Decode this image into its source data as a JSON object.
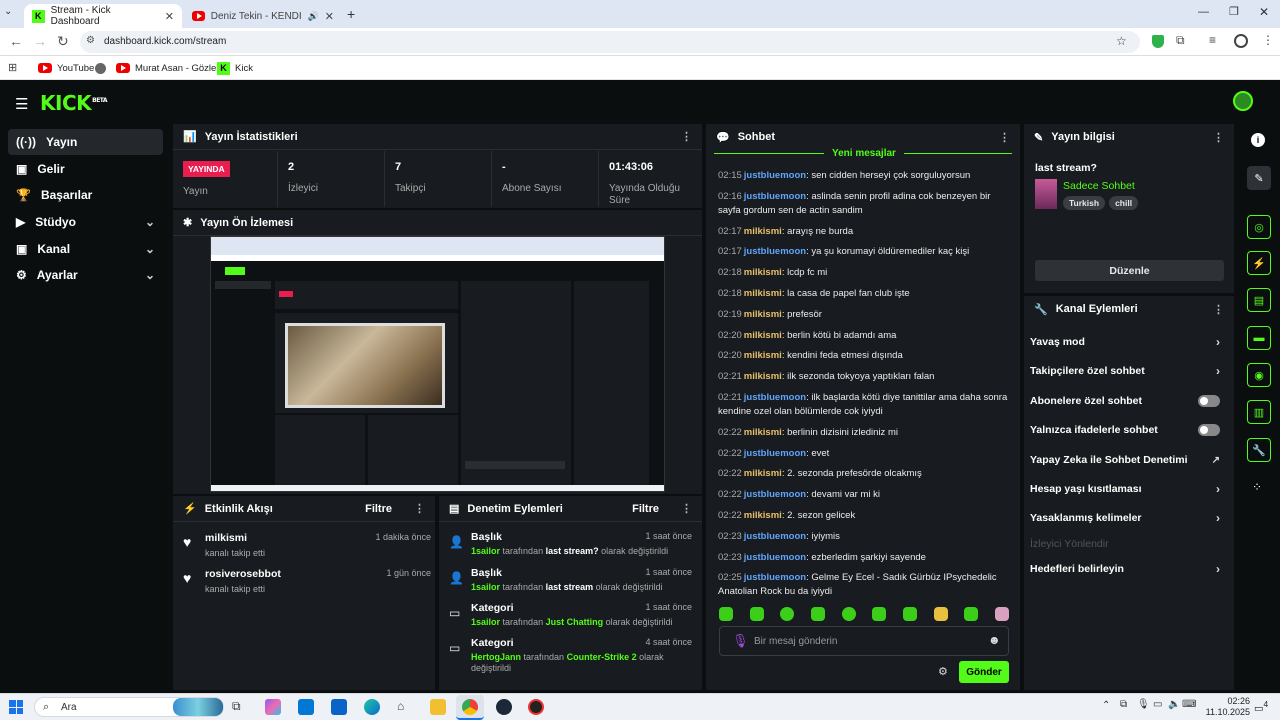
{
  "browser": {
    "tabs": [
      {
        "title": "Stream - Kick Dashboard",
        "active": true
      },
      {
        "title": "Deniz Tekin - KENDİNE İYİ B",
        "active": false
      }
    ],
    "url": "dashboard.kick.com/stream",
    "bookmarks": [
      "YouTube",
      "Murat Asan - Gözler...",
      "Kick"
    ]
  },
  "kick": {
    "logo": "KICK",
    "logo_beta": "BETA"
  },
  "sidebar": {
    "items": [
      {
        "label": "Yayın",
        "icon": "broadcast-icon",
        "active": true,
        "chevron": false
      },
      {
        "label": "Gelir",
        "icon": "wallet-icon",
        "active": false,
        "chevron": false
      },
      {
        "label": "Başarılar",
        "icon": "trophy-icon",
        "active": false,
        "chevron": false
      },
      {
        "label": "Stüdyo",
        "icon": "camera-icon",
        "active": false,
        "chevron": true
      },
      {
        "label": "Kanal",
        "icon": "user-icon",
        "active": false,
        "chevron": true
      },
      {
        "label": "Ayarlar",
        "icon": "gear-icon",
        "active": false,
        "chevron": true
      }
    ]
  },
  "stats": {
    "title": "Yayın İstatistikleri",
    "live_badge": "YAYINDA",
    "live_label": "Yayın",
    "viewers_value": "2",
    "viewers_label": "İzleyici",
    "followers_value": "7",
    "followers_label": "Takipçi",
    "subs_value": "-",
    "subs_label": "Abone Sayısı",
    "uptime_value": "01:43:06",
    "uptime_label": "Yayında Olduğu Süre"
  },
  "preview": {
    "title": "Yayın Ön İzlemesi"
  },
  "activity": {
    "title": "Etkinlik Akışı",
    "filter": "Filtre",
    "items": [
      {
        "user": "milkismi",
        "sub": "kanalı takip etti",
        "time": "1 dakika önce"
      },
      {
        "user": "rosiverosebbot",
        "sub": "kanalı takip etti",
        "time": "1 gün önce"
      }
    ]
  },
  "moderation": {
    "title": "Denetim Eylemleri",
    "filter": "Filtre",
    "items": [
      {
        "heading": "Başlık",
        "user": "1sailor",
        "by": "tarafından",
        "value": "last stream?",
        "tail": "olarak değiştirildi",
        "time": "1 saat önce",
        "icon": "person-edit-icon"
      },
      {
        "heading": "Başlık",
        "user": "1sailor",
        "by": "tarafından",
        "value": "last stream",
        "tail": "olarak değiştirildi",
        "time": "1 saat önce",
        "icon": "person-edit-icon"
      },
      {
        "heading": "Kategori",
        "user": "1sailor",
        "by": "tarafından",
        "value": "Just Chatting",
        "tail": "olarak değiştirildi",
        "time": "1 saat önce",
        "icon": "category-icon"
      },
      {
        "heading": "Kategori",
        "user": "HertogJann",
        "by": "tarafından",
        "value": "Counter-Strike 2",
        "tail": "olarak değiştirildi",
        "time": "4 saat önce",
        "icon": "category-icon"
      }
    ]
  },
  "chat": {
    "title": "Sohbet",
    "new_messages": "Yeni mesajlar",
    "messages": [
      {
        "time": "02:15",
        "user": "justbluemoon",
        "text": "sen cidden herseyi çok sorguluyorsun",
        "color": "#60a5fa"
      },
      {
        "time": "02:16",
        "user": "justbluemoon",
        "text": "aslinda senin profil adina cok benzeyen bir sayfa gordum sen de actin sandim",
        "color": "#60a5fa"
      },
      {
        "time": "02:17",
        "user": "milkismi",
        "text": "arayış ne burda",
        "color": "#e8c06a"
      },
      {
        "time": "02:17",
        "user": "justbluemoon",
        "text": "ya şu korumayi öldüremediler kaç kişi",
        "color": "#60a5fa"
      },
      {
        "time": "02:18",
        "user": "milkismi",
        "text": "lcdp fc mi",
        "color": "#e8c06a"
      },
      {
        "time": "02:18",
        "user": "milkismi",
        "text": "la casa de papel fan club işte",
        "color": "#e8c06a"
      },
      {
        "time": "02:19",
        "user": "milkismi",
        "text": "prefesör",
        "color": "#e8c06a"
      },
      {
        "time": "02:20",
        "user": "milkismi",
        "text": "berlin kötü bi adamdı ama",
        "color": "#e8c06a"
      },
      {
        "time": "02:20",
        "user": "milkismi",
        "text": "kendini feda etmesi dışında",
        "color": "#e8c06a"
      },
      {
        "time": "02:21",
        "user": "milkismi",
        "text": "ilk sezonda tokyoya yaptıkları falan",
        "color": "#e8c06a"
      },
      {
        "time": "02:21",
        "user": "justbluemoon",
        "text": "ilk başlarda kötü diye tanittilar ama daha sonra kendine ozel olan bölümlerde cok iyiydi",
        "color": "#60a5fa"
      },
      {
        "time": "02:22",
        "user": "milkismi",
        "text": "berlinin dizisini izlediniz mi",
        "color": "#e8c06a"
      },
      {
        "time": "02:22",
        "user": "justbluemoon",
        "text": "evet",
        "color": "#60a5fa"
      },
      {
        "time": "02:22",
        "user": "milkismi",
        "text": "2. sezonda prefesörde olcakmış",
        "color": "#e8c06a"
      },
      {
        "time": "02:22",
        "user": "justbluemoon",
        "text": "devami var mi ki",
        "color": "#60a5fa"
      },
      {
        "time": "02:22",
        "user": "milkismi",
        "text": "2. sezon gelicek",
        "color": "#e8c06a"
      },
      {
        "time": "02:23",
        "user": "justbluemoon",
        "text": "iyiymis",
        "color": "#60a5fa"
      },
      {
        "time": "02:23",
        "user": "justbluemoon",
        "text": "ezberledim şarkiyi sayende",
        "color": "#60a5fa"
      },
      {
        "time": "02:25",
        "user": "justbluemoon",
        "text": "Gelme Ey Ecel - Sadık Gürbüz IPsychedelic Anatolian Rock bu da iyiydi",
        "color": "#60a5fa"
      }
    ],
    "input_placeholder": "Bir mesaj gönderin",
    "send": "Gönder"
  },
  "stream_info": {
    "title": "Yayın bilgisi",
    "stream_title": "last stream?",
    "category": "Sadece Sohbet",
    "tags": [
      "Turkish",
      "chill"
    ],
    "edit": "Düzenle"
  },
  "channel_actions": {
    "title": "Kanal Eylemleri",
    "items": [
      {
        "label": "Yavaş mod",
        "control": "chevron"
      },
      {
        "label": "Takipçilere özel sohbet",
        "control": "chevron"
      },
      {
        "label": "Abonelere özel sohbet",
        "control": "toggle"
      },
      {
        "label": "Yalnızca ifadelerle sohbet",
        "control": "toggle"
      },
      {
        "label": "Yapay Zeka ile Sohbet Denetimi",
        "control": "external"
      },
      {
        "label": "Hesap yaşı kısıtlaması",
        "control": "chevron"
      },
      {
        "label": "Yasaklanmış kelimeler",
        "control": "chevron"
      },
      {
        "label": "İzleyici Yönlendir",
        "control": "disabled"
      },
      {
        "label": "Hedefleri belirleyin",
        "control": "chevron"
      }
    ]
  },
  "taskbar": {
    "search": "Ara",
    "time": "02:26",
    "date": "11.10.2025",
    "notifications": "4"
  },
  "colors": {
    "accent": "#53fc18",
    "live": "#e91e4f",
    "panel": "#181b1f",
    "bg": "#0b0e0f"
  }
}
